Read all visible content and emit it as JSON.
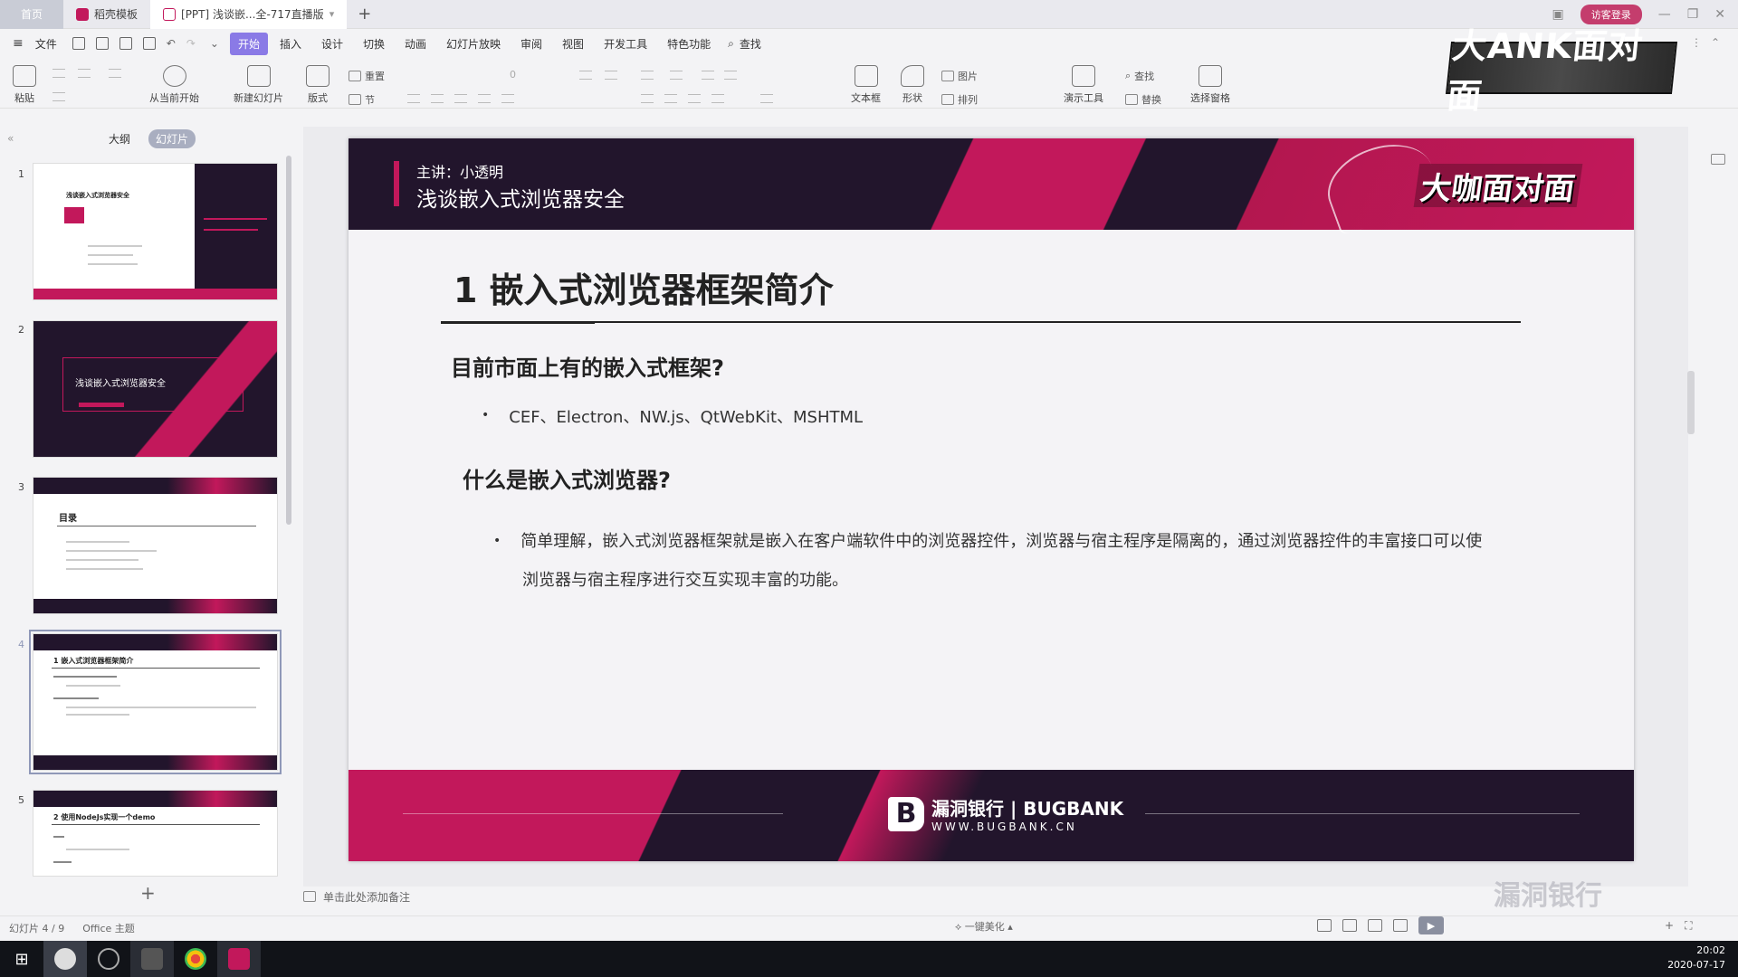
{
  "window": {
    "home_tab": "首页",
    "tabs": [
      {
        "label": "稻壳模板",
        "color": "#c2185b"
      },
      {
        "label": "[PPT] 浅谈嵌...全-717直播版",
        "color": "#c2185b"
      }
    ],
    "add_tab": "+",
    "login_label": "访客登录"
  },
  "menu": {
    "file_label": "文件",
    "items": [
      "开始",
      "插入",
      "设计",
      "切换",
      "动画",
      "幻灯片放映",
      "审阅",
      "视图",
      "开发工具",
      "特色功能"
    ],
    "active": "开始",
    "search_label": "查找"
  },
  "ribbon": {
    "paste": "粘贴",
    "from_current": "从当前开始",
    "new_slide": "新建幻灯片",
    "layout": "版式",
    "reset": "重置",
    "section": "节",
    "font_size": "0",
    "textbox": "文本框",
    "shape": "形状",
    "picture": "图片",
    "arrange": "排列",
    "present_tools": "演示工具",
    "find": "查找",
    "replace": "替换",
    "select_pane": "选择窗格",
    "logo_text": "大ANK面对面"
  },
  "left_panel": {
    "tab_outline": "大纲",
    "tab_slides": "幻灯片",
    "thumbnails": [
      {
        "num": "1",
        "title": "浅谈嵌入式浏览器安全"
      },
      {
        "num": "2",
        "title": "浅谈嵌入式浏览器安全"
      },
      {
        "num": "3",
        "title": "目录"
      },
      {
        "num": "4",
        "title": "1 嵌入式浏览器框架简介"
      },
      {
        "num": "5",
        "title": "2 使用NodeJs实现一个demo"
      }
    ],
    "add_slide": "+"
  },
  "slide": {
    "speaker": "主讲：小透明",
    "subtitle": "浅谈嵌入式浏览器安全",
    "brand": "大咖面对面",
    "title": "1 嵌入式浏览器框架简介",
    "q1": "目前市面上有的嵌入式框架?",
    "q1_bullet": "CEF、Electron、NW.js、QtWebKit、MSHTML",
    "q2": "什么是嵌入式浏览器?",
    "q2_para_line1": "简单理解，嵌入式浏览器框架就是嵌入在客户端软件中的浏览器控件，浏览器与宿主程序是隔离的，通过浏览器控件的丰富接口可以使",
    "q2_para_line2": "浏览器与宿主程序进行交互实现丰富的功能。",
    "footer_cn": "漏洞银行",
    "footer_en": "BUGBANK",
    "footer_url": "WWW.BUGBANK.CN",
    "colors": {
      "dark": "#22152c",
      "accent": "#c2185b"
    }
  },
  "notes_placeholder": "单击此处添加备注",
  "status": {
    "slide_count": "幻灯片 4 / 9",
    "theme": "Office 主题",
    "beautify": "一键美化",
    "zoom_plus": "+"
  },
  "watermark": "漏洞银行",
  "taskbar": {
    "time": "20:02",
    "date": "2020-07-17"
  }
}
